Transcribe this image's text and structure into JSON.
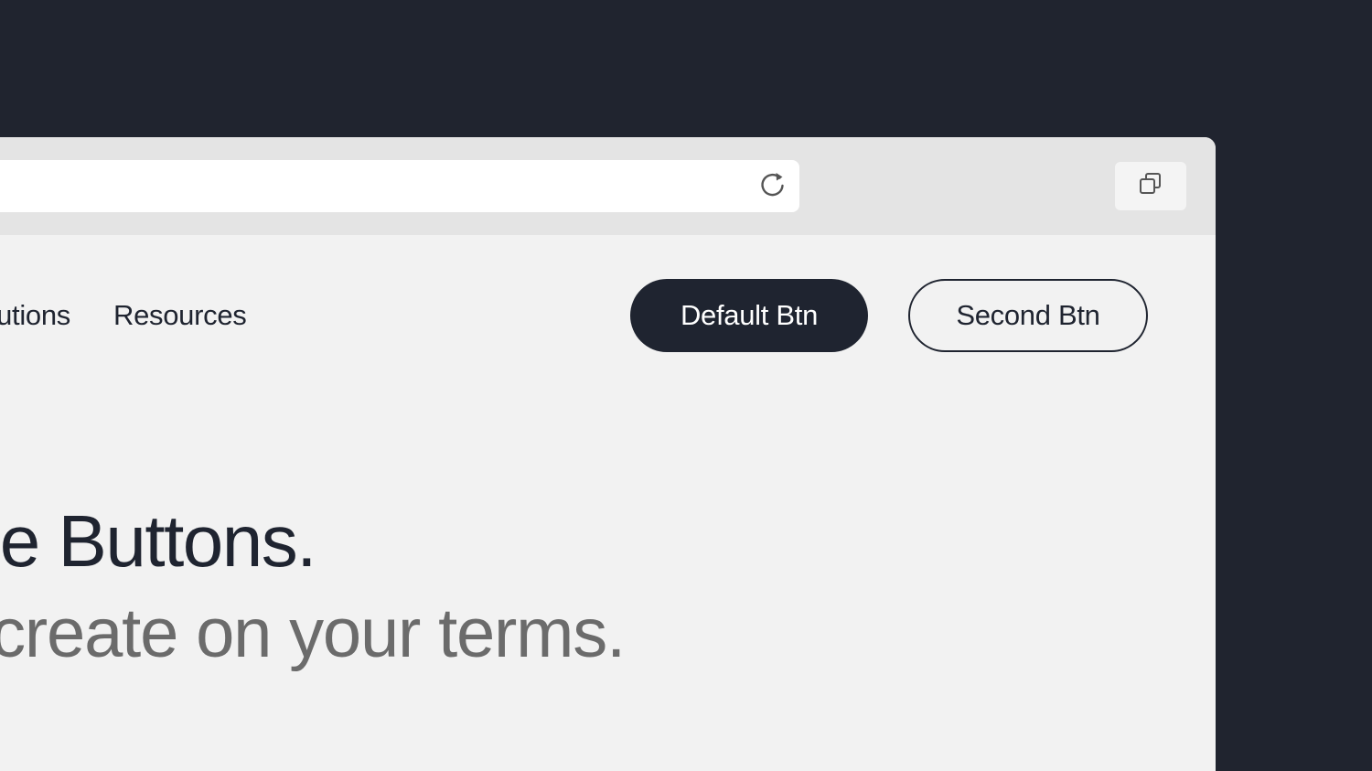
{
  "nav": {
    "solutions_label": "utions",
    "resources_label": "Resources"
  },
  "buttons": {
    "default_label": "Default Btn",
    "second_label": "Second Btn"
  },
  "hero": {
    "headline": "e Buttons.",
    "subheadline": "create on your terms."
  },
  "colors": {
    "background": "#20242f",
    "page": "#f2f2f2",
    "toolbar": "#e4e4e4",
    "primary": "#1f2430",
    "muted_text": "#6b6b6b"
  },
  "icons": {
    "reload": "reload-icon",
    "tabs": "tabs-overview-icon"
  }
}
